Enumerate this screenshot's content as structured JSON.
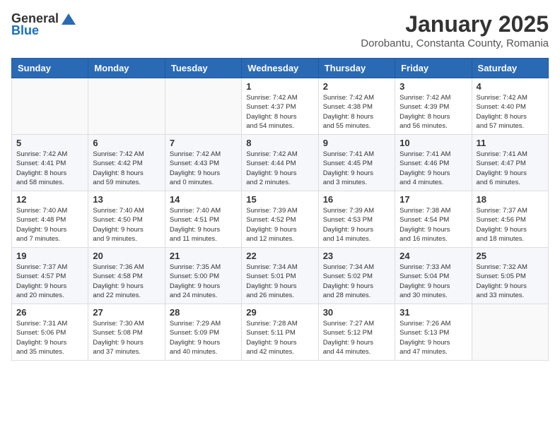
{
  "logo": {
    "general": "General",
    "blue": "Blue"
  },
  "title": {
    "month_year": "January 2025",
    "location": "Dorobantu, Constanta County, Romania"
  },
  "days_of_week": [
    "Sunday",
    "Monday",
    "Tuesday",
    "Wednesday",
    "Thursday",
    "Friday",
    "Saturday"
  ],
  "weeks": [
    [
      {
        "day": "",
        "info": ""
      },
      {
        "day": "",
        "info": ""
      },
      {
        "day": "",
        "info": ""
      },
      {
        "day": "1",
        "info": "Sunrise: 7:42 AM\nSunset: 4:37 PM\nDaylight: 8 hours\nand 54 minutes."
      },
      {
        "day": "2",
        "info": "Sunrise: 7:42 AM\nSunset: 4:38 PM\nDaylight: 8 hours\nand 55 minutes."
      },
      {
        "day": "3",
        "info": "Sunrise: 7:42 AM\nSunset: 4:39 PM\nDaylight: 8 hours\nand 56 minutes."
      },
      {
        "day": "4",
        "info": "Sunrise: 7:42 AM\nSunset: 4:40 PM\nDaylight: 8 hours\nand 57 minutes."
      }
    ],
    [
      {
        "day": "5",
        "info": "Sunrise: 7:42 AM\nSunset: 4:41 PM\nDaylight: 8 hours\nand 58 minutes."
      },
      {
        "day": "6",
        "info": "Sunrise: 7:42 AM\nSunset: 4:42 PM\nDaylight: 8 hours\nand 59 minutes."
      },
      {
        "day": "7",
        "info": "Sunrise: 7:42 AM\nSunset: 4:43 PM\nDaylight: 9 hours\nand 0 minutes."
      },
      {
        "day": "8",
        "info": "Sunrise: 7:42 AM\nSunset: 4:44 PM\nDaylight: 9 hours\nand 2 minutes."
      },
      {
        "day": "9",
        "info": "Sunrise: 7:41 AM\nSunset: 4:45 PM\nDaylight: 9 hours\nand 3 minutes."
      },
      {
        "day": "10",
        "info": "Sunrise: 7:41 AM\nSunset: 4:46 PM\nDaylight: 9 hours\nand 4 minutes."
      },
      {
        "day": "11",
        "info": "Sunrise: 7:41 AM\nSunset: 4:47 PM\nDaylight: 9 hours\nand 6 minutes."
      }
    ],
    [
      {
        "day": "12",
        "info": "Sunrise: 7:40 AM\nSunset: 4:48 PM\nDaylight: 9 hours\nand 7 minutes."
      },
      {
        "day": "13",
        "info": "Sunrise: 7:40 AM\nSunset: 4:50 PM\nDaylight: 9 hours\nand 9 minutes."
      },
      {
        "day": "14",
        "info": "Sunrise: 7:40 AM\nSunset: 4:51 PM\nDaylight: 9 hours\nand 11 minutes."
      },
      {
        "day": "15",
        "info": "Sunrise: 7:39 AM\nSunset: 4:52 PM\nDaylight: 9 hours\nand 12 minutes."
      },
      {
        "day": "16",
        "info": "Sunrise: 7:39 AM\nSunset: 4:53 PM\nDaylight: 9 hours\nand 14 minutes."
      },
      {
        "day": "17",
        "info": "Sunrise: 7:38 AM\nSunset: 4:54 PM\nDaylight: 9 hours\nand 16 minutes."
      },
      {
        "day": "18",
        "info": "Sunrise: 7:37 AM\nSunset: 4:56 PM\nDaylight: 9 hours\nand 18 minutes."
      }
    ],
    [
      {
        "day": "19",
        "info": "Sunrise: 7:37 AM\nSunset: 4:57 PM\nDaylight: 9 hours\nand 20 minutes."
      },
      {
        "day": "20",
        "info": "Sunrise: 7:36 AM\nSunset: 4:58 PM\nDaylight: 9 hours\nand 22 minutes."
      },
      {
        "day": "21",
        "info": "Sunrise: 7:35 AM\nSunset: 5:00 PM\nDaylight: 9 hours\nand 24 minutes."
      },
      {
        "day": "22",
        "info": "Sunrise: 7:34 AM\nSunset: 5:01 PM\nDaylight: 9 hours\nand 26 minutes."
      },
      {
        "day": "23",
        "info": "Sunrise: 7:34 AM\nSunset: 5:02 PM\nDaylight: 9 hours\nand 28 minutes."
      },
      {
        "day": "24",
        "info": "Sunrise: 7:33 AM\nSunset: 5:04 PM\nDaylight: 9 hours\nand 30 minutes."
      },
      {
        "day": "25",
        "info": "Sunrise: 7:32 AM\nSunset: 5:05 PM\nDaylight: 9 hours\nand 33 minutes."
      }
    ],
    [
      {
        "day": "26",
        "info": "Sunrise: 7:31 AM\nSunset: 5:06 PM\nDaylight: 9 hours\nand 35 minutes."
      },
      {
        "day": "27",
        "info": "Sunrise: 7:30 AM\nSunset: 5:08 PM\nDaylight: 9 hours\nand 37 minutes."
      },
      {
        "day": "28",
        "info": "Sunrise: 7:29 AM\nSunset: 5:09 PM\nDaylight: 9 hours\nand 40 minutes."
      },
      {
        "day": "29",
        "info": "Sunrise: 7:28 AM\nSunset: 5:11 PM\nDaylight: 9 hours\nand 42 minutes."
      },
      {
        "day": "30",
        "info": "Sunrise: 7:27 AM\nSunset: 5:12 PM\nDaylight: 9 hours\nand 44 minutes."
      },
      {
        "day": "31",
        "info": "Sunrise: 7:26 AM\nSunset: 5:13 PM\nDaylight: 9 hours\nand 47 minutes."
      },
      {
        "day": "",
        "info": ""
      }
    ]
  ]
}
